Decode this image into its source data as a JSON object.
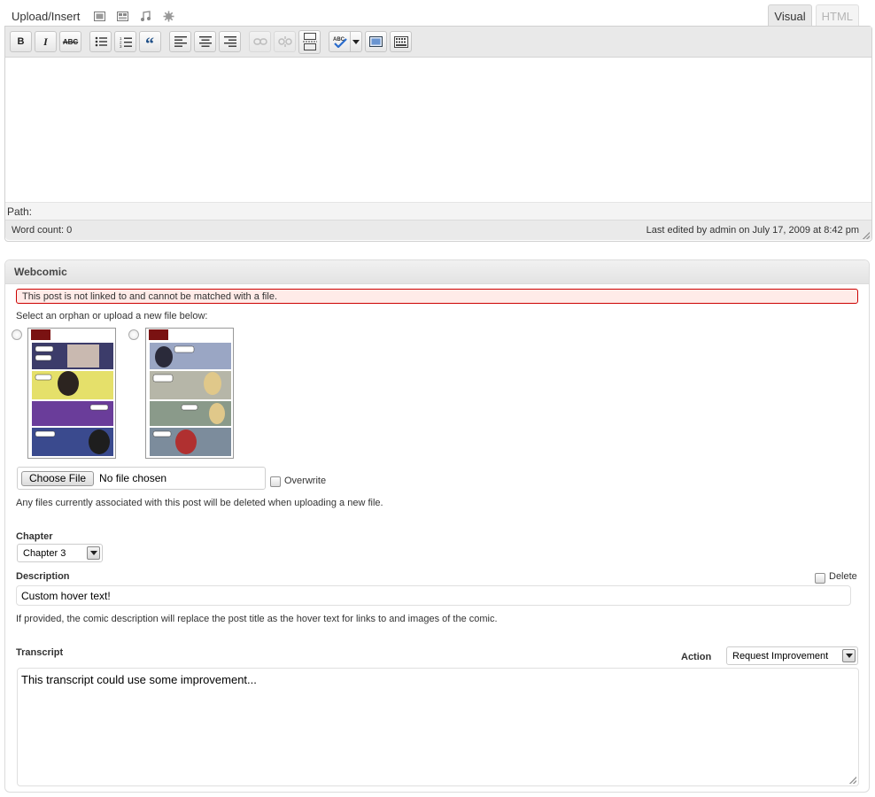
{
  "media_bar": {
    "label": "Upload/Insert",
    "buttons": [
      "add-image-icon",
      "add-video-icon",
      "add-audio-icon",
      "add-media-icon"
    ]
  },
  "tabs": [
    {
      "label": "Visual",
      "active": true
    },
    {
      "label": "HTML",
      "active": false
    }
  ],
  "toolbar": {
    "bold": "B",
    "italic": "I",
    "strike": "ABC"
  },
  "editor": {
    "path_label": "Path:",
    "word_count": "Word count: 0",
    "last_edited": "Last edited by admin on July 17, 2009 at 8:42 pm"
  },
  "webcomic": {
    "title": "Webcomic",
    "error": "This post is not linked to and cannot be matched with a file.",
    "orphan_prompt": "Select an orphan or upload a new file below:",
    "file": {
      "button": "Choose File",
      "status": "No file chosen",
      "overwrite_label": "Overwrite",
      "note": "Any files currently associated with this post will be deleted when uploading a new file."
    },
    "chapter": {
      "label": "Chapter",
      "selected": "Chapter 3"
    },
    "description": {
      "label": "Description",
      "delete_label": "Delete",
      "value": "Custom hover text!",
      "note": "If provided, the comic description will replace the post title as the hover text for links to and images of the comic."
    },
    "transcript": {
      "label": "Transcript",
      "action_label": "Action",
      "action_selected": "Request Improvement",
      "value": "This transcript could use some improvement..."
    }
  },
  "colors": {
    "error_bg": "#ffebe8",
    "error_border": "#cc0000",
    "toolbar_bg": "#e9e9e9"
  }
}
